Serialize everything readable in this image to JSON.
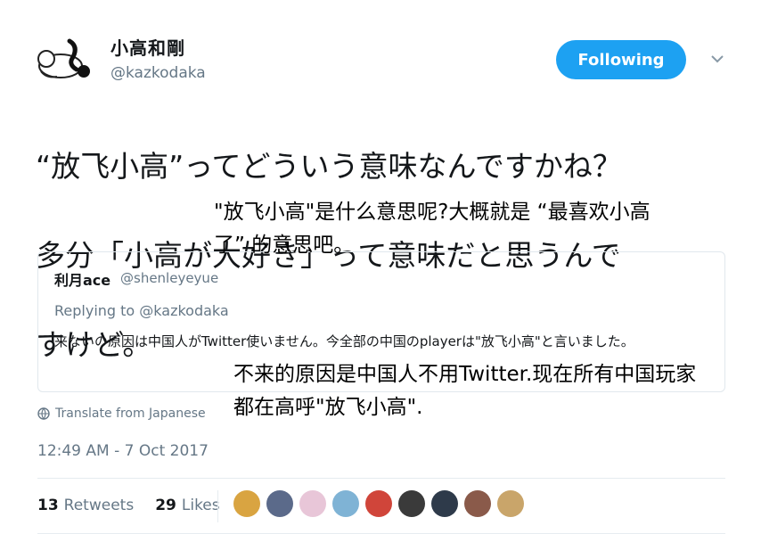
{
  "tweet": {
    "author": {
      "display_name": "小高和剛",
      "handle": "@kazkodaka"
    },
    "follow_button_label": "Following",
    "text_lines": [
      "“放飞小高”ってどういう意味なんですかね？",
      "多分「小高が大好き」って意味だと思うんで",
      "すけど。"
    ],
    "translate_label": "Translate from Japanese",
    "timestamp": "12:49 AM - 7 Oct 2017",
    "stats": {
      "retweets_count": "13",
      "retweets_label": "Retweets",
      "likes_count": "29",
      "likes_label": "Likes"
    }
  },
  "quoted_tweet": {
    "author_name": "利月ace",
    "author_handle": "@shenleyeyue",
    "replying_to": "Replying to @kazkodaka",
    "text": "来ないの原因は中国人がTwitter使いません。今全部の中国のplayerは\"放飞小高\"と言いました。"
  },
  "subtitles": {
    "tweet_translation": "\"放飞小高\"是什么意思呢?大概就是 “最喜欢小高了” 的意思吧。",
    "quote_translation": "不来的原因是中国人不用Twitter.现在所有中国玩家都在高呼\"放飞小高\"."
  },
  "colors": {
    "accent": "#1da1f2",
    "secondary_text": "#657786",
    "border": "#e1e8ed"
  },
  "likers": [
    {
      "icon": "liker-avatar",
      "color": "#d9a441"
    },
    {
      "icon": "liker-avatar",
      "color": "#5b6a8a"
    },
    {
      "icon": "liker-avatar",
      "color": "#e8c6d8"
    },
    {
      "icon": "liker-avatar",
      "color": "#7fb3d5"
    },
    {
      "icon": "liker-avatar",
      "color": "#d0453a"
    },
    {
      "icon": "liker-avatar",
      "color": "#3a3a3a"
    },
    {
      "icon": "liker-avatar",
      "color": "#2e3a4a"
    },
    {
      "icon": "liker-avatar",
      "color": "#8a5a4a"
    },
    {
      "icon": "liker-avatar",
      "color": "#c9a56a"
    }
  ]
}
